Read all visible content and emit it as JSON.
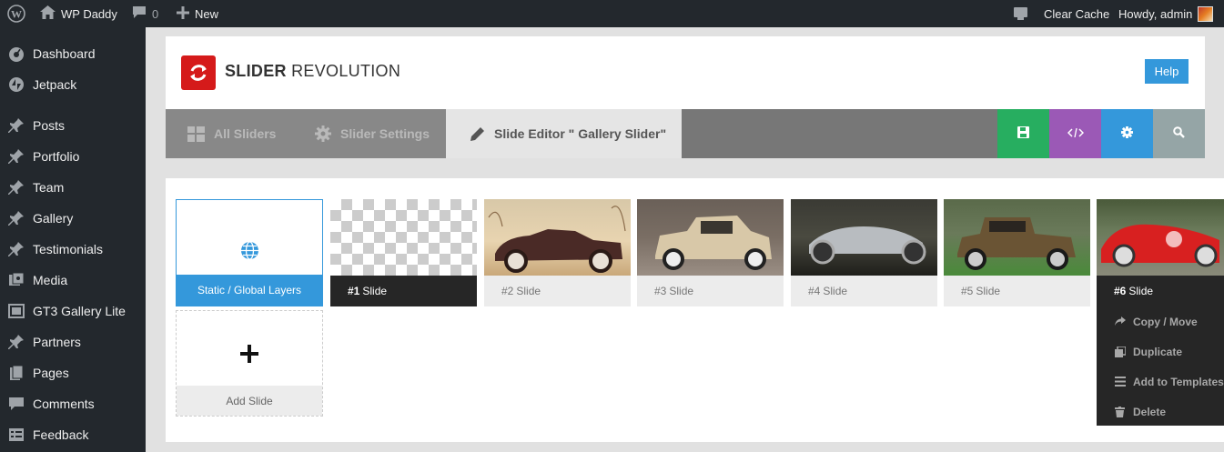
{
  "adminbar": {
    "site_name": "WP Daddy",
    "comments_count": "0",
    "new_label": "New",
    "clear_cache": "Clear Cache",
    "howdy": "Howdy, admin"
  },
  "sidebar": {
    "items": [
      {
        "label": "Dashboard",
        "icon": "dashboard-icon"
      },
      {
        "label": "Jetpack",
        "icon": "jetpack-icon"
      },
      {
        "label": "Posts",
        "icon": "pin-icon"
      },
      {
        "label": "Portfolio",
        "icon": "pin-icon"
      },
      {
        "label": "Team",
        "icon": "pin-icon"
      },
      {
        "label": "Gallery",
        "icon": "pin-icon"
      },
      {
        "label": "Testimonials",
        "icon": "pin-icon"
      },
      {
        "label": "Media",
        "icon": "media-icon"
      },
      {
        "label": "GT3 Gallery Lite",
        "icon": "gallery-icon"
      },
      {
        "label": "Partners",
        "icon": "pin-icon"
      },
      {
        "label": "Pages",
        "icon": "pages-icon"
      },
      {
        "label": "Comments",
        "icon": "comments-icon"
      },
      {
        "label": "Feedback",
        "icon": "feedback-icon"
      }
    ]
  },
  "header": {
    "title_bold": "SLIDER",
    "title_light": "REVOLUTION",
    "help": "Help"
  },
  "tabs": {
    "all_sliders": "All Sliders",
    "slider_settings": "Slider Settings",
    "slide_editor": "Slide Editor \" Gallery Slider\""
  },
  "actions": {
    "colors": {
      "save": "#27ae60",
      "code": "#9b59b6",
      "settings": "#3498db",
      "search": "#95a5a6"
    }
  },
  "slides": {
    "static_label": "Static / Global Layers",
    "add_label": "Add Slide",
    "items": [
      {
        "num": "#1",
        "label": "Slide"
      },
      {
        "num": "#2",
        "label": "Slide"
      },
      {
        "num": "#3",
        "label": "Slide"
      },
      {
        "num": "#4",
        "label": "Slide"
      },
      {
        "num": "#5",
        "label": "Slide"
      },
      {
        "num": "#6",
        "label": "Slide"
      }
    ]
  },
  "context_menu": {
    "copy_move": "Copy / Move",
    "duplicate": "Duplicate",
    "add_templates": "Add to Templates",
    "delete": "Delete"
  }
}
